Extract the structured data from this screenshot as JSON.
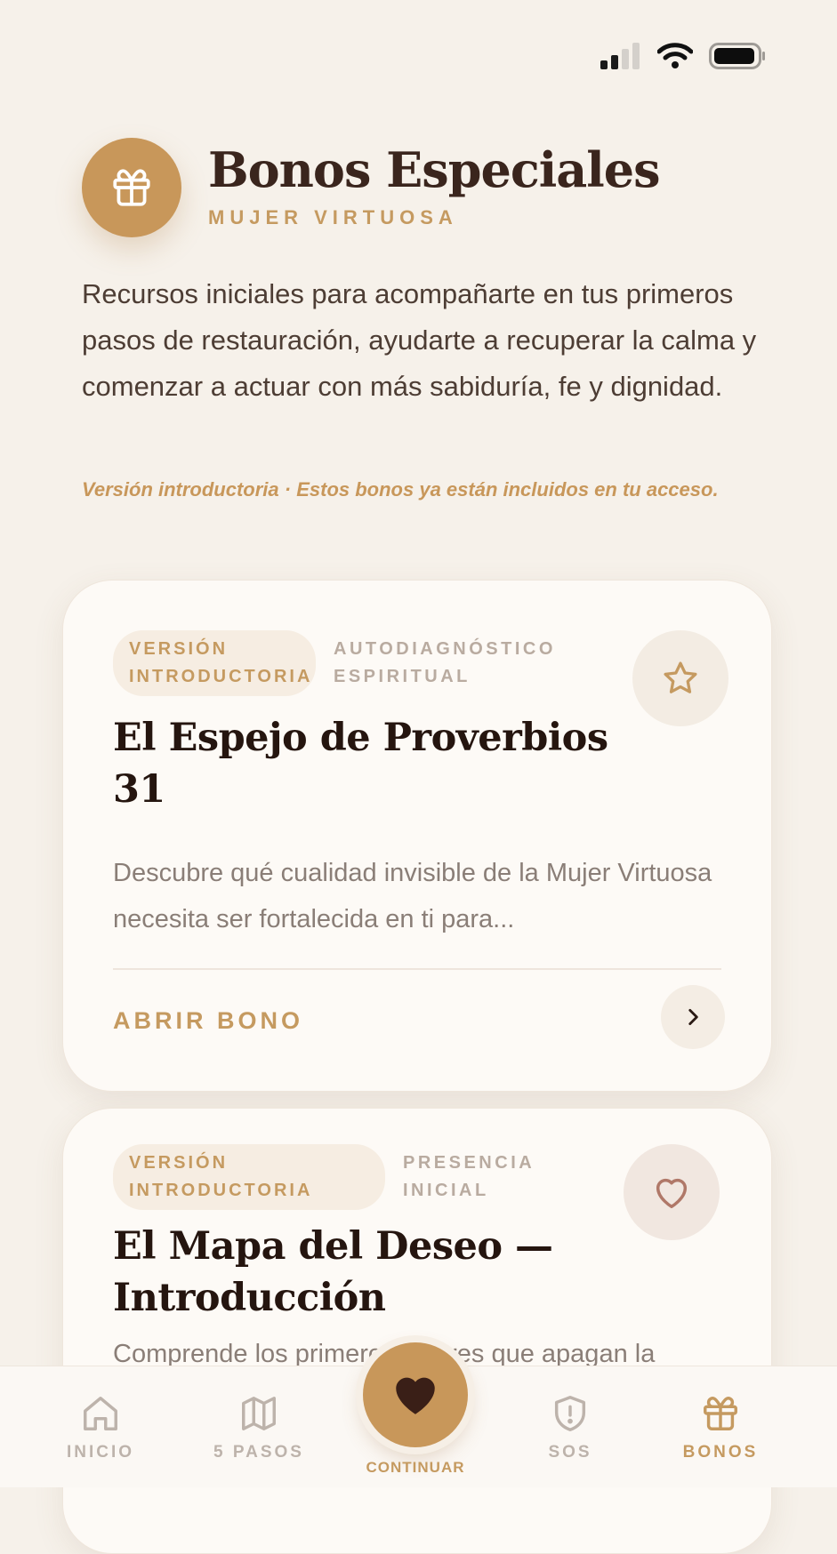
{
  "header": {
    "title": "Bonos Especiales",
    "subtitle": "MUJER VIRTUOSA",
    "icon": "gift-icon"
  },
  "intro": "Recursos iniciales para acompañarte en tus primeros pasos de restauración, ayudarte a recuperar la calma y comenzar a actuar con más sabiduría, fe y dignidad.",
  "note": "Versión introductoria · Estos bonos ya están incluidos en tu acceso.",
  "cards": [
    {
      "tag": "VERSIÓN INTRODUCTORIA",
      "category": "AUTODIAGNÓSTICO ESPIRITUAL",
      "title": "El Espejo de Proverbios 31",
      "description": "Descubre qué cualidad invisible de la Mujer Virtuosa necesita ser fortalecida en ti para...",
      "action": "ABRIR BONO",
      "icon": "star-icon"
    },
    {
      "tag": "VERSIÓN INTRODUCTORIA",
      "category": "PRESENCIA INICIAL",
      "title": "El Mapa del Deseo — Introducción",
      "description": "Comprende los primeros errores que apagan la",
      "icon": "heart-icon"
    }
  ],
  "tabs": [
    {
      "label": "INICIO",
      "icon": "home-icon"
    },
    {
      "label": "5 PASOS",
      "icon": "map-icon"
    },
    {
      "label": "CONTINUAR",
      "icon": "heart-icon"
    },
    {
      "label": "SOS",
      "icon": "shield-alert-icon"
    },
    {
      "label": "BONOS",
      "icon": "gift-icon"
    }
  ],
  "colors": {
    "accent": "#c8975a",
    "background": "#f6f1ea",
    "title": "#3a251d",
    "heart": "#b07868"
  }
}
